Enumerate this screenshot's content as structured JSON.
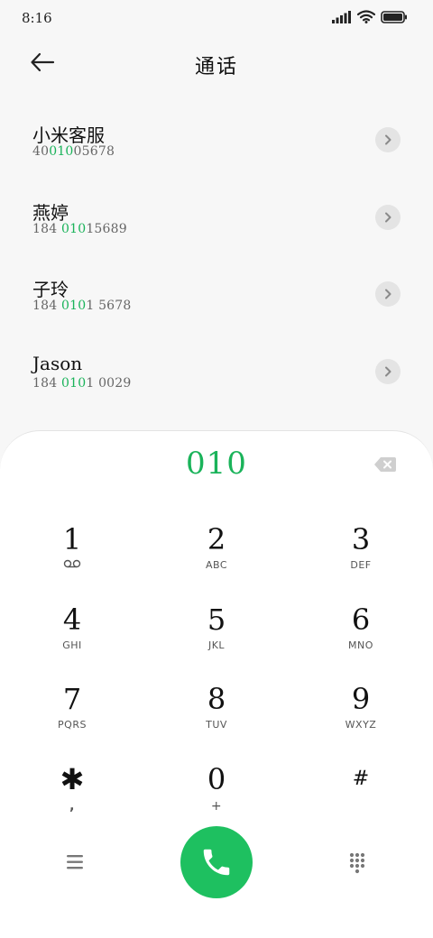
{
  "status_bar": {
    "time": "8:16",
    "icons": [
      "signal-icon",
      "wifi-icon",
      "battery-icon"
    ]
  },
  "header": {
    "title": "通话",
    "back_icon": "arrow-left-icon"
  },
  "contacts": [
    {
      "name": "小米客服",
      "number_pre": "40",
      "number_match": "010",
      "number_post": "05678"
    },
    {
      "name": "燕婷",
      "number_pre": "184 ",
      "number_match": "010",
      "number_post": "15689"
    },
    {
      "name": "子玲",
      "number_pre": "184 ",
      "number_match": "010",
      "number_post": "1 5678"
    },
    {
      "name": "Jason",
      "number_pre": "184 ",
      "number_match": "010",
      "number_post": "1 0029"
    }
  ],
  "dialpad": {
    "input": "010",
    "keys": [
      {
        "digit": "1",
        "letters": ""
      },
      {
        "digit": "2",
        "letters": "ABC"
      },
      {
        "digit": "3",
        "letters": "DEF"
      },
      {
        "digit": "4",
        "letters": "GHI"
      },
      {
        "digit": "5",
        "letters": "JKL"
      },
      {
        "digit": "6",
        "letters": "MNO"
      },
      {
        "digit": "7",
        "letters": "PQRS"
      },
      {
        "digit": "8",
        "letters": "TUV"
      },
      {
        "digit": "9",
        "letters": "WXYZ"
      },
      {
        "digit": "✱",
        "letters": ","
      },
      {
        "digit": "0",
        "letters": "+"
      },
      {
        "digit": "#",
        "letters": ""
      }
    ]
  },
  "colors": {
    "accent": "#1ab35a",
    "call_button": "#1ec060",
    "background": "#f7f7f7",
    "panel": "#ffffff"
  }
}
